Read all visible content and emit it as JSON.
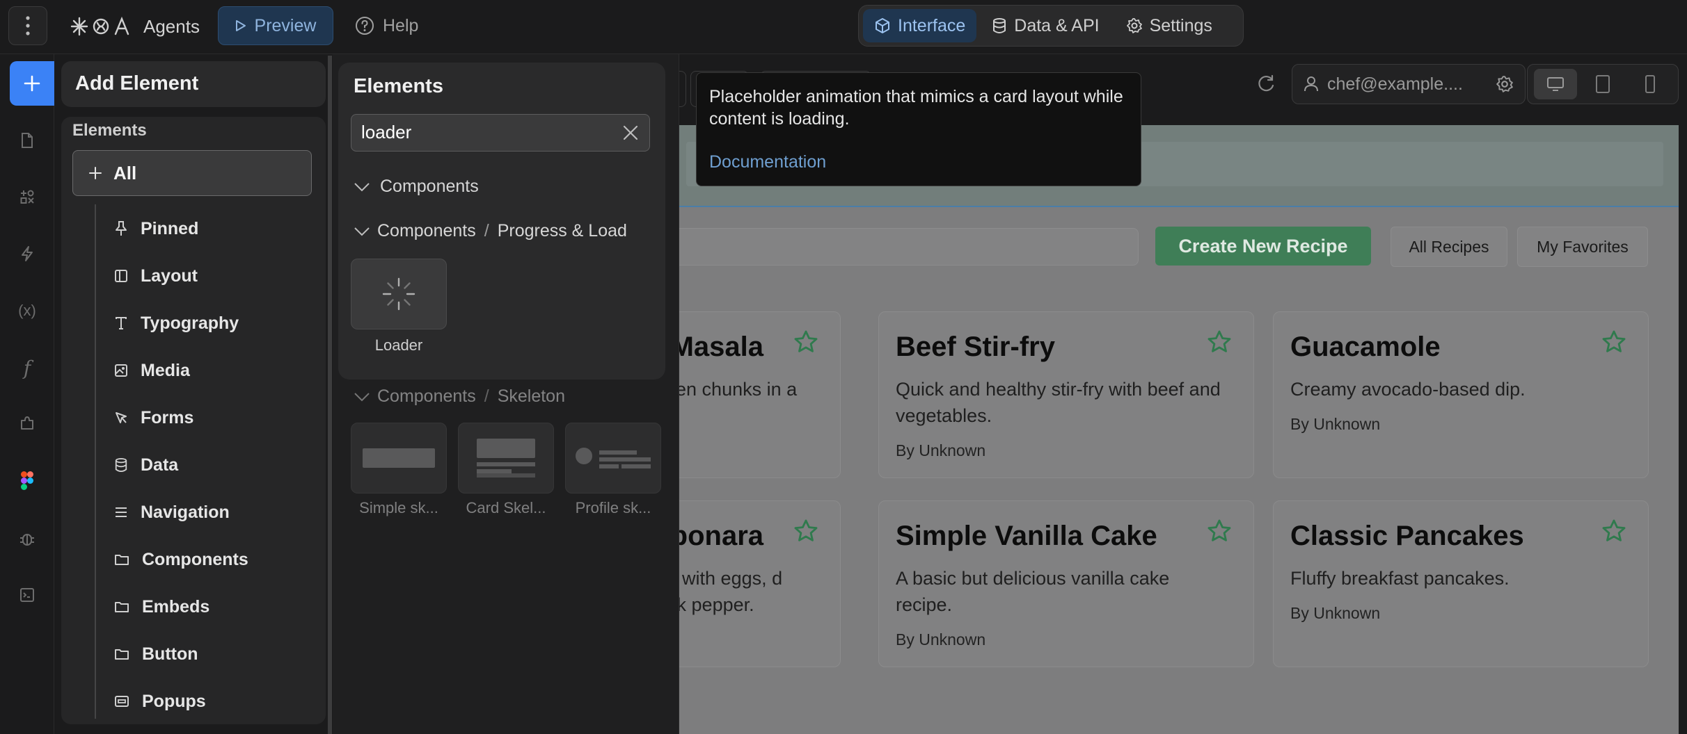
{
  "topbar": {
    "app_name": "Agents",
    "preview_label": "Preview",
    "help_label": "Help",
    "tabs": [
      {
        "label": "Interface",
        "icon": "cube-icon",
        "active": true
      },
      {
        "label": "Data & API",
        "icon": "database-icon",
        "active": false
      },
      {
        "label": "Settings",
        "icon": "gear-icon",
        "active": false
      }
    ]
  },
  "add_panel": {
    "title": "Add Element",
    "section_heading": "Elements",
    "all_label": "All",
    "categories": [
      {
        "label": "Pinned",
        "icon": "pin-icon"
      },
      {
        "label": "Layout",
        "icon": "layout-icon"
      },
      {
        "label": "Typography",
        "icon": "text-icon"
      },
      {
        "label": "Media",
        "icon": "image-icon"
      },
      {
        "label": "Forms",
        "icon": "cursor-icon"
      },
      {
        "label": "Data",
        "icon": "database-icon"
      },
      {
        "label": "Navigation",
        "icon": "menu-icon"
      },
      {
        "label": "Components",
        "icon": "folder-icon"
      },
      {
        "label": "Embeds",
        "icon": "folder-icon"
      },
      {
        "label": "Button",
        "icon": "folder-icon"
      },
      {
        "label": "Popups",
        "icon": "popup-icon"
      }
    ]
  },
  "elements_panel": {
    "title": "Elements",
    "search_value": "loader",
    "sections": [
      {
        "label": "Components"
      },
      {
        "parent": "Components",
        "separator": "/",
        "label": "Progress & Load"
      },
      {
        "parent": "Components",
        "separator": "/",
        "label": "Skeleton"
      }
    ],
    "loader_tile": {
      "label": "Loader"
    },
    "skeleton_tiles": [
      {
        "label": "Simple sk..."
      },
      {
        "label": "Card Skel..."
      },
      {
        "label": "Profile sk..."
      }
    ]
  },
  "tooltip": {
    "text": "Placeholder animation that mimics a card layout while content is loading.",
    "link": "Documentation"
  },
  "canvas": {
    "user_email": "chef@example....",
    "create_button": "Create New Recipe",
    "filter_all": "All Recipes",
    "filter_favorites": "My Favorites",
    "recipes": [
      {
        "title": "n Masala",
        "desc": "hicken chunks in a",
        "author": ""
      },
      {
        "title": "Beef Stir-fry",
        "desc": "Quick and healthy stir-fry with beef and vegetables.",
        "author": "By Unknown"
      },
      {
        "title": "Guacamole",
        "desc": "Creamy avocado-based dip.",
        "author": "By Unknown"
      },
      {
        "title": "bonara",
        "desc": "dish with eggs, d black pepper.",
        "author": ""
      },
      {
        "title": "Simple Vanilla Cake",
        "desc": "A basic but delicious vanilla cake recipe.",
        "author": "By Unknown"
      },
      {
        "title": "Classic Pancakes",
        "desc": "Fluffy breakfast pancakes.",
        "author": "By Unknown"
      }
    ]
  },
  "colors": {
    "accent_blue": "#3b82f6",
    "create_button_green": "#3f7e57",
    "star_green": "#2f7a4d",
    "link_blue": "#6f9fd0"
  }
}
